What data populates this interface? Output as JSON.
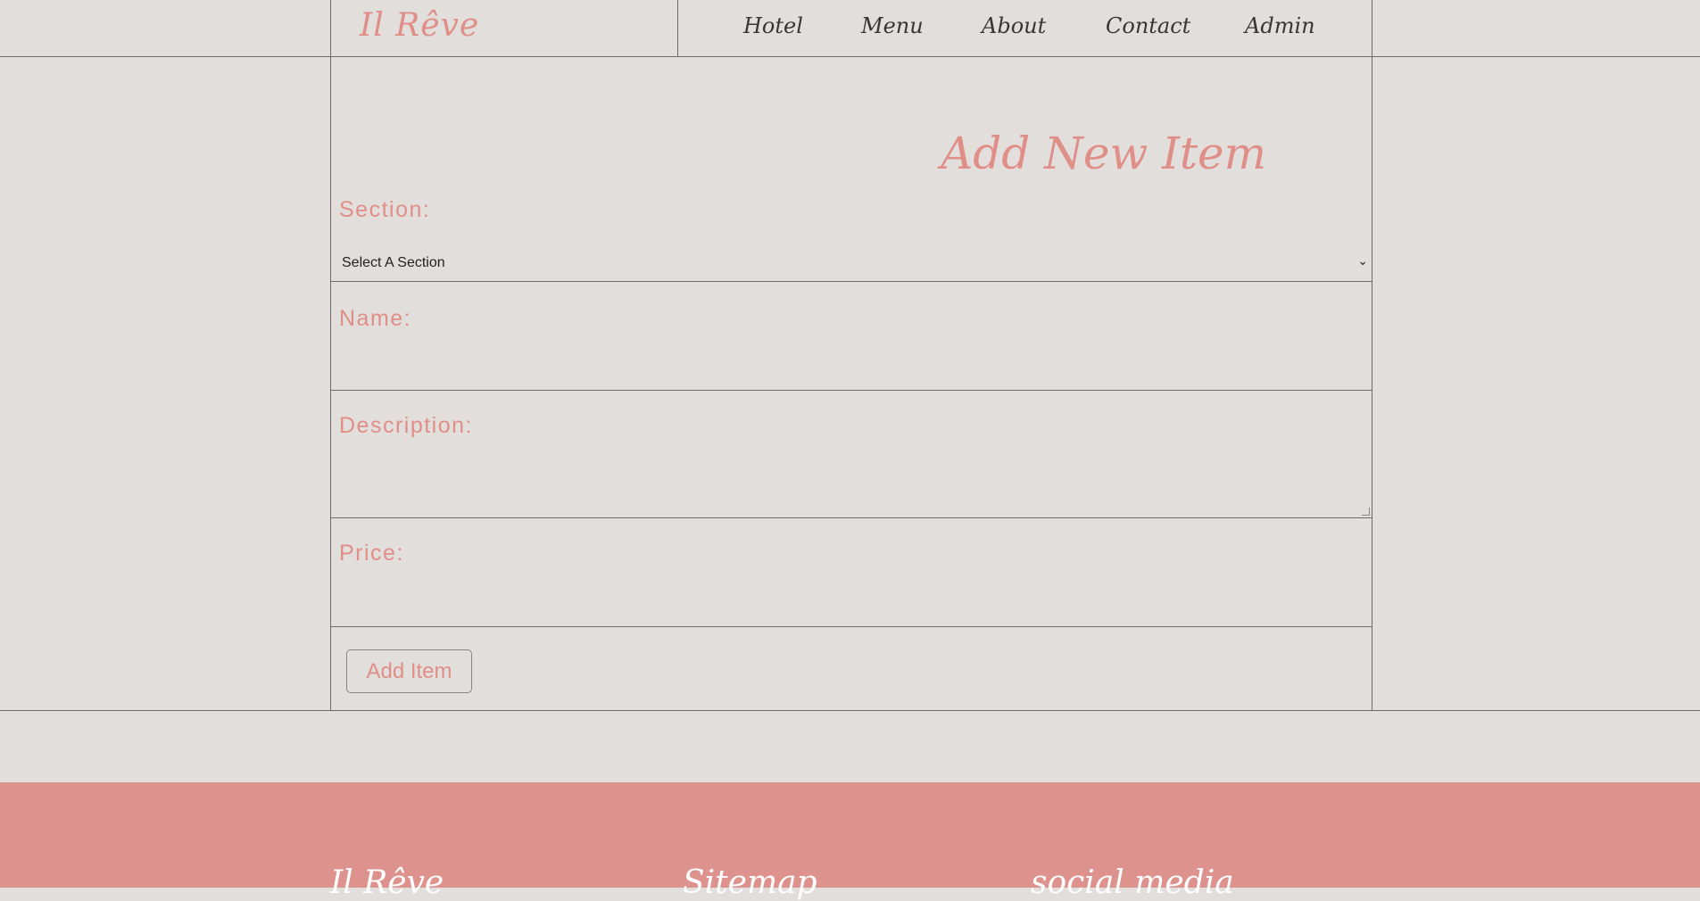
{
  "header": {
    "logo": "Il Rêve",
    "nav": [
      "Hotel",
      "Menu",
      "About",
      "Contact",
      "Admin"
    ]
  },
  "form": {
    "title": "Add New Item",
    "section_label": "Section:",
    "section_value": "Select A Section",
    "name_label": "Name:",
    "name_value": "",
    "description_label": "Description:",
    "description_value": "",
    "price_label": "Price:",
    "price_value": "",
    "submit_label": "Add Item"
  },
  "footer": {
    "brand": "Il Rêve",
    "sitemap": "Sitemap",
    "social": "social media"
  },
  "colors": {
    "background": "#e2dedb",
    "accent": "#e08e88",
    "footer": "#de928e",
    "border": "#6f6a67"
  }
}
